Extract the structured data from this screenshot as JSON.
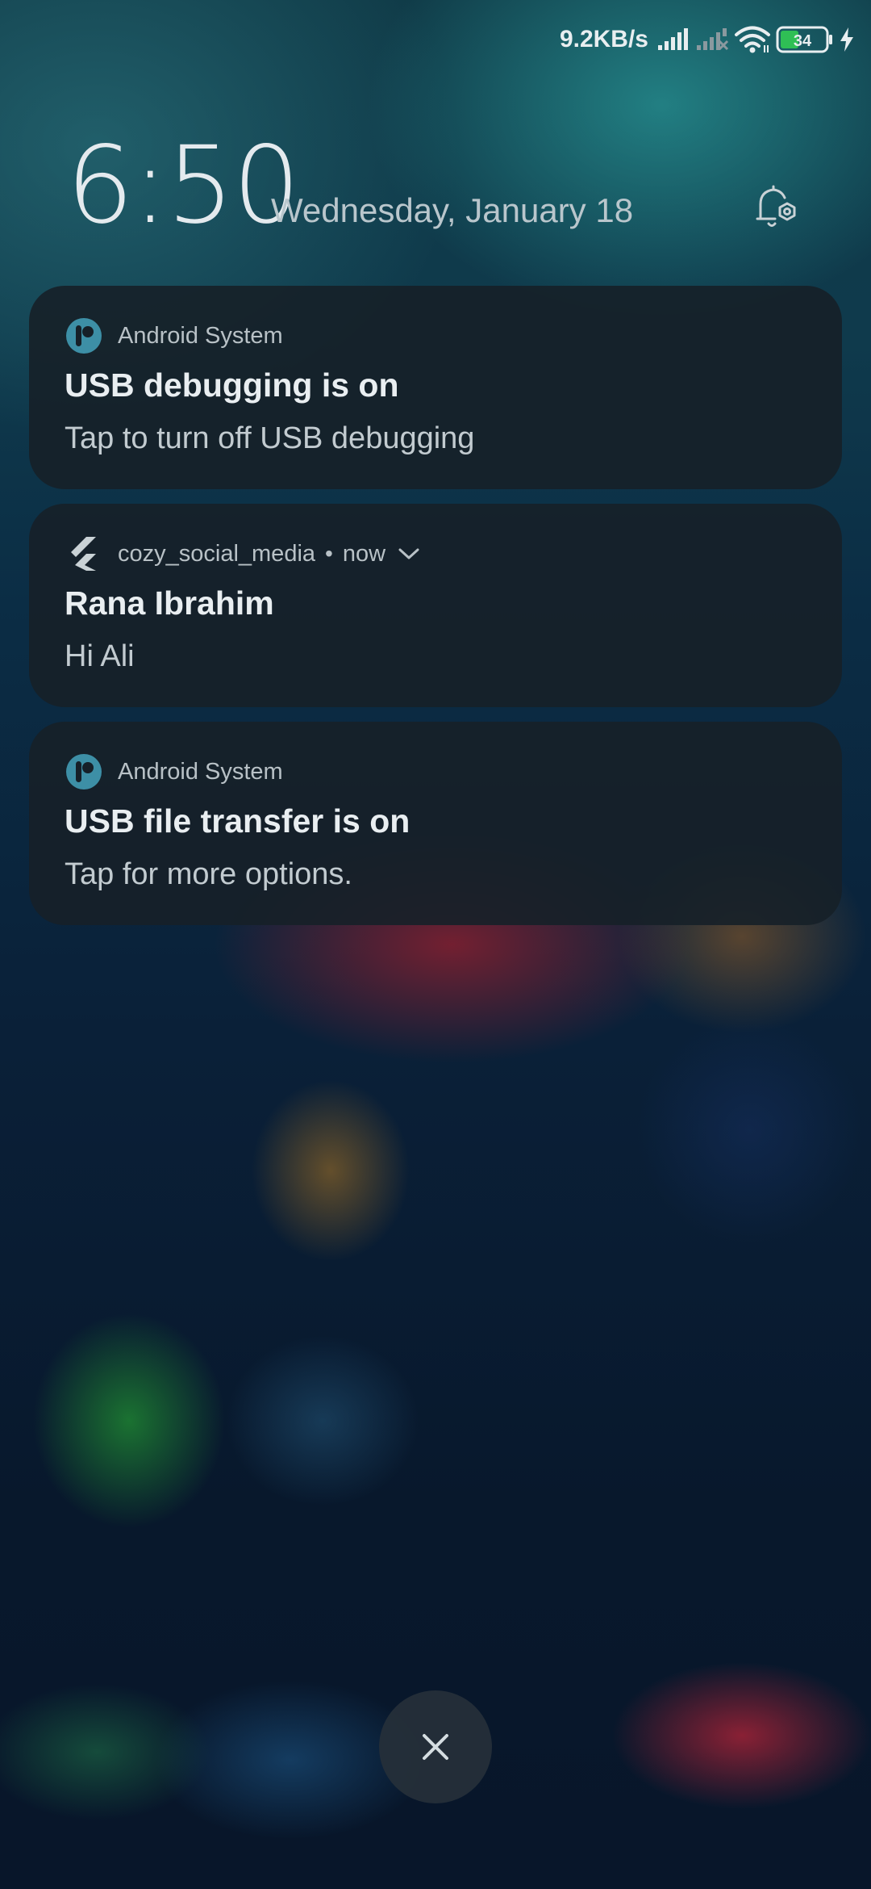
{
  "status_bar": {
    "network_speed": "9.2KB/s",
    "battery_level": "34",
    "icons": [
      "signal-icon",
      "signal-no-service-icon",
      "wifi-icon",
      "battery-icon",
      "charging-icon"
    ]
  },
  "lockscreen": {
    "time": "6:50",
    "date": "Wednesday, January 18",
    "settings_icon": "notification-settings-icon"
  },
  "notifications": [
    {
      "app": "Android System",
      "icon": "android-system-icon",
      "title": "USB debugging is on",
      "body": "Tap to turn off USB debugging"
    },
    {
      "app": "cozy_social_media",
      "icon": "flutter-icon",
      "separator": "•",
      "time": "now",
      "title": "Rana Ibrahim",
      "body": "Hi Ali"
    },
    {
      "app": "Android System",
      "icon": "android-system-icon",
      "title": "USB file transfer is on",
      "body": "Tap for more options."
    }
  ],
  "clear_button": {
    "icon": "close-icon"
  },
  "colors": {
    "card_background": "#162028",
    "accent_teal": "#3d8fa6",
    "battery_green": "#2fbf55",
    "text_primary": "#e9eef1",
    "text_secondary": "#b8c1c6"
  }
}
